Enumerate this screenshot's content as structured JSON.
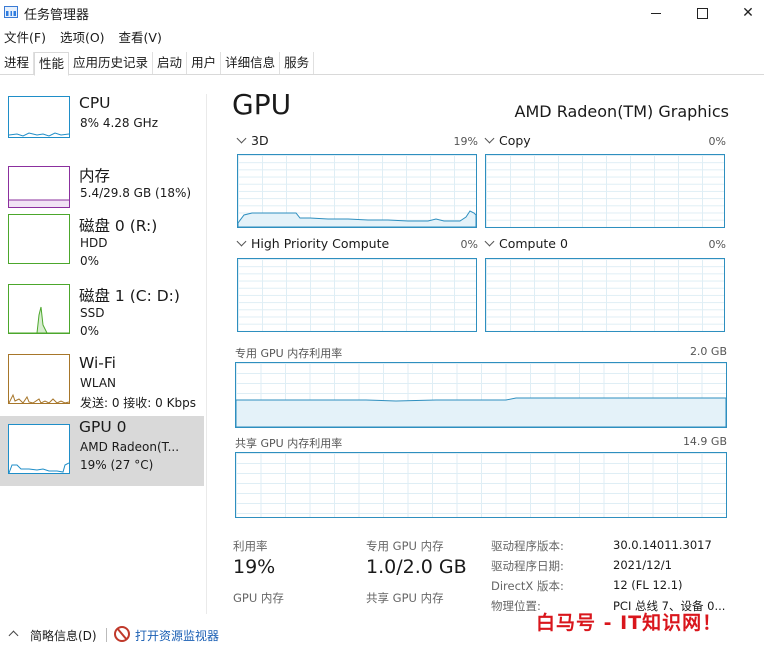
{
  "window": {
    "title": "任务管理器"
  },
  "menu": [
    "文件(F)",
    "选项(O)",
    "查看(V)"
  ],
  "tabs": [
    "进程",
    "性能",
    "应用历史记录",
    "启动",
    "用户",
    "详细信息",
    "服务"
  ],
  "active_tab": "性能",
  "sidebar": {
    "items": [
      {
        "name": "CPU",
        "line2": "8% 4.28 GHz",
        "line3": "",
        "color": "#1f8ec8"
      },
      {
        "name": "内存",
        "line2": "5.4/29.8 GB (18%)",
        "line3": "",
        "color": "#8b2f9e"
      },
      {
        "name": "磁盘 0 (R:)",
        "line2": "HDD",
        "line3": "0%",
        "color": "#4ca72c"
      },
      {
        "name": "磁盘 1 (C: D:)",
        "line2": "SSD",
        "line3": "0%",
        "color": "#4ca72c"
      },
      {
        "name": "Wi-Fi",
        "line2": "WLAN",
        "line3": "发送: 0 接收: 0 Kbps",
        "color": "#a7762a"
      },
      {
        "name": "GPU 0",
        "line2": "AMD Radeon(T...",
        "line3": "19% (27 °C)",
        "color": "#1f8ec8"
      }
    ]
  },
  "main": {
    "title": "GPU",
    "model": "AMD Radeon(TM) Graphics",
    "graphs": [
      {
        "label": "3D",
        "pct": "19%"
      },
      {
        "label": "Copy",
        "pct": "0%"
      },
      {
        "label": "High Priority Compute",
        "pct": "0%"
      },
      {
        "label": "Compute 0",
        "pct": "0%"
      }
    ],
    "dedicated_mem": {
      "label": "专用 GPU 内存利用率",
      "max": "2.0 GB"
    },
    "shared_mem": {
      "label": "共享 GPU 内存利用率",
      "max": "14.9 GB"
    }
  },
  "stats": {
    "utilization_label": "利用率",
    "utilization_value": "19%",
    "dedicated_label": "专用 GPU 内存",
    "dedicated_value": "1.0/2.0 GB",
    "gpu_mem_label": "GPU 内存",
    "shared_label": "共享 GPU 内存"
  },
  "info": [
    {
      "label": "驱动程序版本:",
      "value": "30.0.14011.3017"
    },
    {
      "label": "驱动程序日期:",
      "value": "2021/12/1"
    },
    {
      "label": "DirectX 版本:",
      "value": "12 (FL 12.1)"
    },
    {
      "label": "物理位置:",
      "value": "PCI 总线 7、设备 0..."
    }
  ],
  "footer": {
    "fewer_details": "简略信息(D)",
    "resource_monitor": "打开资源监视器",
    "watermark": "白马号 - IT知识网！"
  }
}
